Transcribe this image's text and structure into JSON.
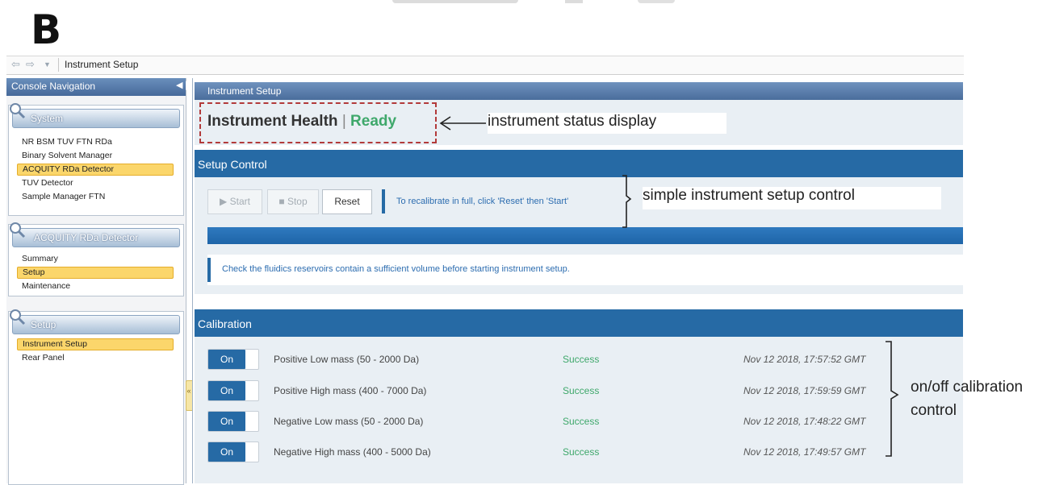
{
  "figure_label": "B",
  "address_bar": {
    "text": "Instrument Setup"
  },
  "sidebar": {
    "title": "Console Navigation",
    "panels": [
      {
        "title": "System",
        "items": [
          "NR BSM TUV FTN RDa",
          "Binary Solvent Manager",
          "ACQUITY RDa Detector",
          "TUV Detector",
          "Sample Manager FTN"
        ],
        "selected": 2
      },
      {
        "title": "ACQUITY RDa Detector",
        "items": [
          "Summary",
          "Setup",
          "Maintenance"
        ],
        "selected": 1
      },
      {
        "title": "Setup",
        "items": [
          "Instrument Setup",
          "Rear Panel"
        ],
        "selected": 0
      }
    ]
  },
  "main": {
    "header": "Instrument Setup",
    "health_label": "Instrument Health",
    "health_sep": "|",
    "health_status": "Ready",
    "setup_control": {
      "title": "Setup Control",
      "start_label": "Start",
      "stop_label": "Stop",
      "reset_label": "Reset",
      "hint": "To recalibrate in full, click 'Reset' then 'Start'",
      "check_msg": "Check the fluidics reservoirs contain a sufficient volume before starting instrument setup."
    },
    "calibration": {
      "title": "Calibration",
      "rows": [
        {
          "toggle": "On",
          "name": "Positive Low mass (50 - 2000 Da)",
          "status": "Success",
          "time": "Nov 12 2018, 17:57:52 GMT"
        },
        {
          "toggle": "On",
          "name": "Positive High mass (400 - 7000 Da)",
          "status": "Success",
          "time": "Nov 12 2018, 17:59:59 GMT"
        },
        {
          "toggle": "On",
          "name": "Negative Low mass (50 - 2000 Da)",
          "status": "Success",
          "time": "Nov 12 2018, 17:48:22 GMT"
        },
        {
          "toggle": "On",
          "name": "Negative High mass (400 - 5000 Da)",
          "status": "Success",
          "time": "Nov 12 2018, 17:49:57 GMT"
        }
      ]
    }
  },
  "annotations": {
    "status": "instrument status display",
    "setup": "simple instrument setup control",
    "calibration_line1": "on/off calibration",
    "calibration_line2": "control"
  }
}
